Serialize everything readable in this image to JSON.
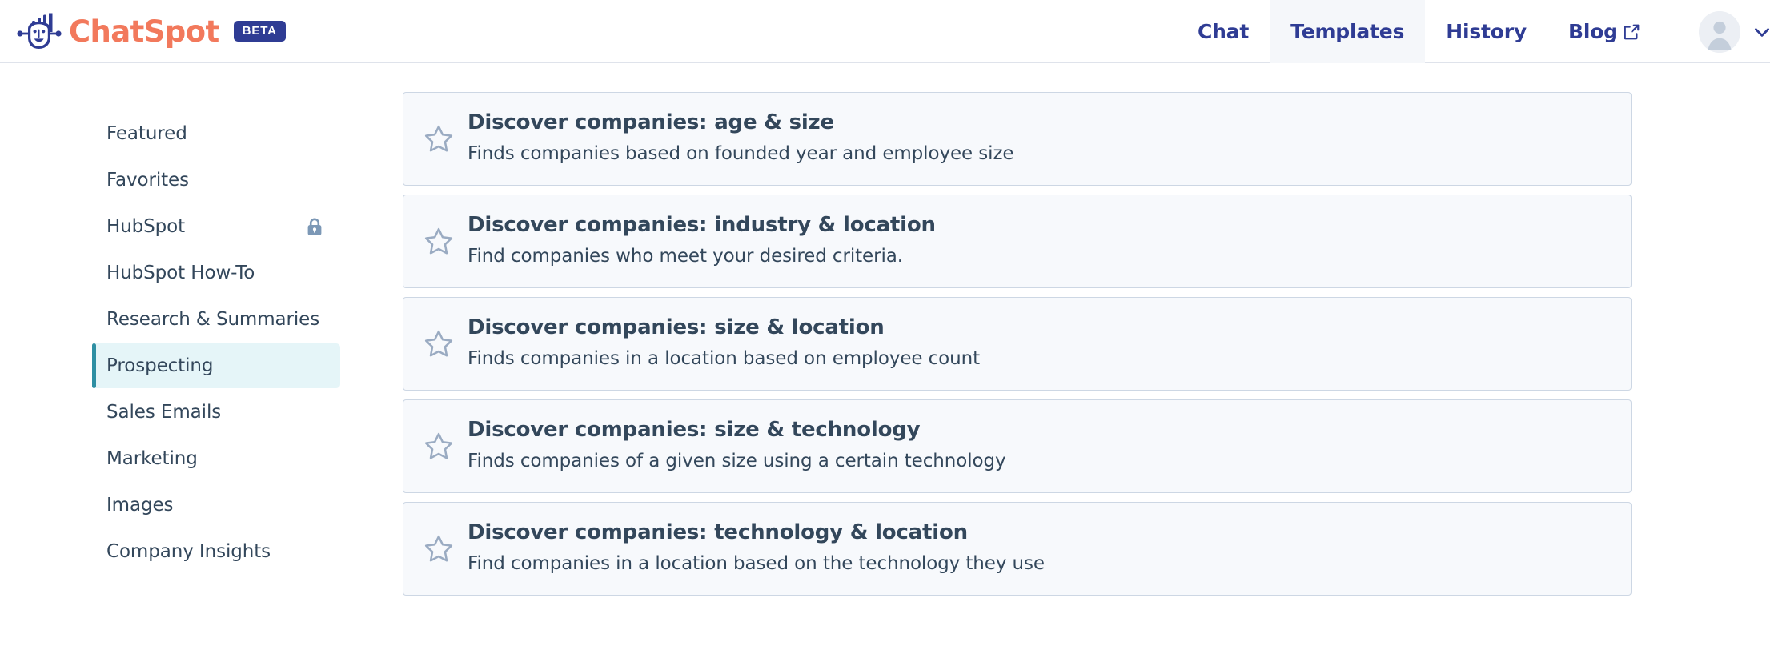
{
  "header": {
    "brand": {
      "logo_icon": "chatspot-face-logo",
      "wordmark": "ChatSpot",
      "badge": "BETA"
    },
    "nav": [
      {
        "label": "Chat",
        "active": false,
        "external": false
      },
      {
        "label": "Templates",
        "active": true,
        "external": false
      },
      {
        "label": "History",
        "active": false,
        "external": false
      },
      {
        "label": "Blog",
        "active": false,
        "external": true
      }
    ],
    "account": {
      "avatar_icon": "user-avatar-icon",
      "chevron_icon": "chevron-down-icon"
    },
    "colors": {
      "nav_text": "#2f3c94",
      "brand_orange": "#f2795c",
      "badge_bg": "#2f3c94",
      "active_tab_bg": "#f5f7fa",
      "border": "#dfe3eb"
    }
  },
  "sidebar": {
    "items": [
      {
        "label": "Featured",
        "active": false,
        "locked": false
      },
      {
        "label": "Favorites",
        "active": false,
        "locked": false
      },
      {
        "label": "HubSpot",
        "active": false,
        "locked": true
      },
      {
        "label": "HubSpot How-To",
        "active": false,
        "locked": false
      },
      {
        "label": "Research & Summaries",
        "active": false,
        "locked": false
      },
      {
        "label": "Prospecting",
        "active": true,
        "locked": false
      },
      {
        "label": "Sales Emails",
        "active": false,
        "locked": false
      },
      {
        "label": "Marketing",
        "active": false,
        "locked": false
      },
      {
        "label": "Images",
        "active": false,
        "locked": false
      },
      {
        "label": "Company Insights",
        "active": false,
        "locked": false
      }
    ],
    "colors": {
      "active_bg": "#e5f5f8",
      "active_bar": "#2e8fa3",
      "text": "#33475b",
      "lock": "#7c98b6"
    }
  },
  "templates": {
    "cards": [
      {
        "title": "Discover companies: age & size",
        "description": "Finds companies based on founded year and employee size",
        "favorite": false
      },
      {
        "title": "Discover companies: industry & location",
        "description": "Find companies who meet your desired criteria.",
        "favorite": false
      },
      {
        "title": "Discover companies: size & location",
        "description": "Finds companies in a location based on employee count",
        "favorite": false
      },
      {
        "title": "Discover companies: size & technology",
        "description": "Finds companies of a given size using a certain technology",
        "favorite": false
      },
      {
        "title": "Discover companies: technology & location",
        "description": "Find companies in a location based on the technology they use",
        "favorite": false
      }
    ],
    "star_icon": "star-outline-icon",
    "colors": {
      "card_bg": "#f7f9fc",
      "card_border": "#cdd7e4",
      "title": "#33475b",
      "star": "#9aabc2"
    }
  }
}
